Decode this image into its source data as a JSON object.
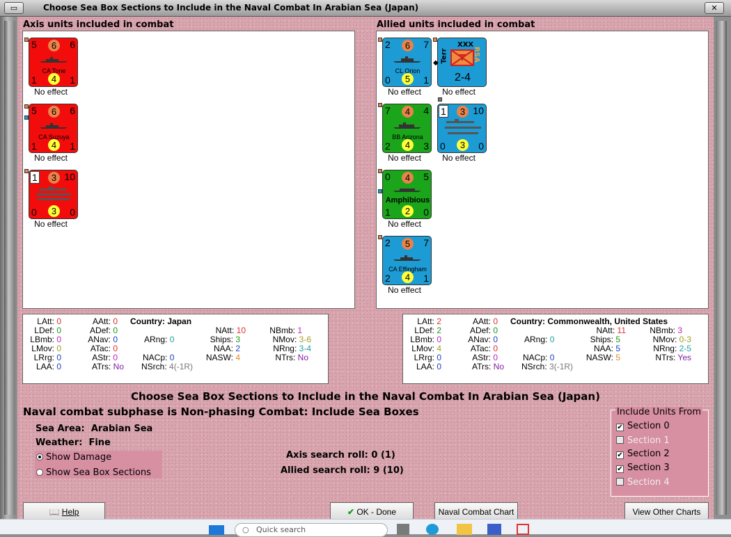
{
  "window": {
    "title": "Choose Sea Box Sections to Include in the Naval Combat In Arabian Sea (Japan)"
  },
  "axis_panel": {
    "label": "Axis units included in combat",
    "units": [
      {
        "name": "CA Tone",
        "tl": "5",
        "tc": "6",
        "tr": "6",
        "bl": "1",
        "bc": "4",
        "br": "1",
        "effect": "No effect",
        "color": "#f20c0c"
      },
      {
        "name": "CA Suzuya",
        "tl": "5",
        "tc": "6",
        "tr": "6",
        "bl": "1",
        "bc": "4",
        "br": "1",
        "effect": "No effect",
        "color": "#f20c0c"
      },
      {
        "name": "",
        "tl": "1",
        "tc": "3",
        "tr": "10",
        "bl": "0",
        "bc": "3",
        "br": "0",
        "effect": "No effect",
        "color": "#f20c0c"
      }
    ]
  },
  "allied_panel": {
    "label": "Allied units included in combat",
    "units": [
      {
        "name": "CL Orion",
        "tl": "2",
        "tc": "6",
        "tr": "7",
        "bl": "0",
        "bc": "5",
        "br": "1",
        "effect": "No effect",
        "color": "#1d9bd4"
      },
      {
        "name": "BB Arizona",
        "tl": "7",
        "tc": "4",
        "tr": "4",
        "bl": "2",
        "bc": "4",
        "br": "3",
        "effect": "No effect",
        "color": "#1aa51a"
      },
      {
        "name": "Amphibious",
        "tl": "0",
        "tc": "4",
        "tr": "5",
        "bl": "1",
        "bc": "2",
        "br": "0",
        "effect": "No effect",
        "color": "#1aa51a"
      },
      {
        "name": "CA Effingham",
        "tl": "2",
        "tc": "5",
        "tr": "7",
        "bl": "2",
        "bc": "4",
        "br": "1",
        "effect": "No effect",
        "color": "#1d9bd4"
      }
    ],
    "land_unit": {
      "size": "XXX",
      "side": "Terr",
      "nation": "RSA",
      "strength": "2-4",
      "effect": "No effect"
    },
    "carrier_unit": {
      "tl": "1",
      "tc": "3",
      "tr": "10",
      "bl": "0",
      "bc": "3",
      "br": "0",
      "effect": "No effect"
    }
  },
  "axis_stats": {
    "country_label": "Country:",
    "country": "Japan",
    "LAtt": "0",
    "LDef": "0",
    "LBmb": "0",
    "LMov": "0",
    "LRrg": "0",
    "LAA": "0",
    "AAtt": "0",
    "ADef": "0",
    "ANav": "0",
    "ATac": "0",
    "AStr": "0",
    "ATrs": "No",
    "ARng": "0",
    "NACp": "0",
    "NSrch": "4(-1R)",
    "NAtt": "10",
    "Ships": "3",
    "NAA": "2",
    "NASW": "4",
    "NBmb": "1",
    "NMov": "3-6",
    "NRng": "3-4",
    "NTrs": "No"
  },
  "allied_stats": {
    "country_label": "Country:",
    "country": "Commonwealth, United States",
    "LAtt": "2",
    "LDef": "2",
    "LBmb": "0",
    "LMov": "4",
    "LRrg": "0",
    "LAA": "0",
    "AAtt": "0",
    "ADef": "0",
    "ANav": "0",
    "ATac": "0",
    "AStr": "0",
    "ATrs": "No",
    "ARng": "0",
    "NACp": "0",
    "NSrch": "3(-1R)",
    "NAtt": "11",
    "Ships": "5",
    "NAA": "5",
    "NASW": "5",
    "NBmb": "3",
    "NMov": "0-3",
    "NRng": "2-5",
    "NTrs": "Yes"
  },
  "labels": {
    "LAtt": "LAtt:",
    "LDef": "LDef:",
    "LBmb": "LBmb:",
    "LMov": "LMov:",
    "LRrg": "LRrg:",
    "LAA": "LAA:",
    "AAtt": "AAtt:",
    "ADef": "ADef:",
    "ANav": "ANav:",
    "ATac": "ATac:",
    "AStr": "AStr:",
    "ATrs": "ATrs:",
    "ARng": "ARng:",
    "NACp": "NACp:",
    "NSrch": "NSrch:",
    "NAtt": "NAtt:",
    "Ships": "Ships:",
    "NAA": "NAA:",
    "NASW": "NASW:",
    "NBmb": "NBmb:",
    "NMov": "NMov:",
    "NRng": "NRng:",
    "NTrs": "NTrs:"
  },
  "main": {
    "heading": "Choose Sea Box Sections to Include in the Naval Combat In Arabian Sea (Japan)",
    "subphase": "Naval combat subphase is Non-phasing Combat: Include Sea Boxes",
    "sea_area_label": "Sea Area:",
    "sea_area": "Arabian Sea",
    "weather_label": "Weather:",
    "weather": "Fine",
    "axis_roll": "Axis search roll: 0 (1)",
    "allied_roll": "Allied search roll: 9 (10)"
  },
  "view_options": {
    "show_damage": "Show Damage",
    "show_sections": "Show Sea Box Sections"
  },
  "include": {
    "caption": "Include Units From",
    "sections": [
      {
        "label": "Section 0",
        "checked": true,
        "enabled": true
      },
      {
        "label": "Section 1",
        "checked": false,
        "enabled": false
      },
      {
        "label": "Section 2",
        "checked": true,
        "enabled": true
      },
      {
        "label": "Section 3",
        "checked": true,
        "enabled": true
      },
      {
        "label": "Section 4",
        "checked": false,
        "enabled": false
      }
    ]
  },
  "buttons": {
    "help": "Help",
    "ok": "OK - Done",
    "naval_chart": "Naval Combat Chart",
    "other_charts": "View Other Charts"
  },
  "taskbar": {
    "search_placeholder": "Quick search"
  }
}
